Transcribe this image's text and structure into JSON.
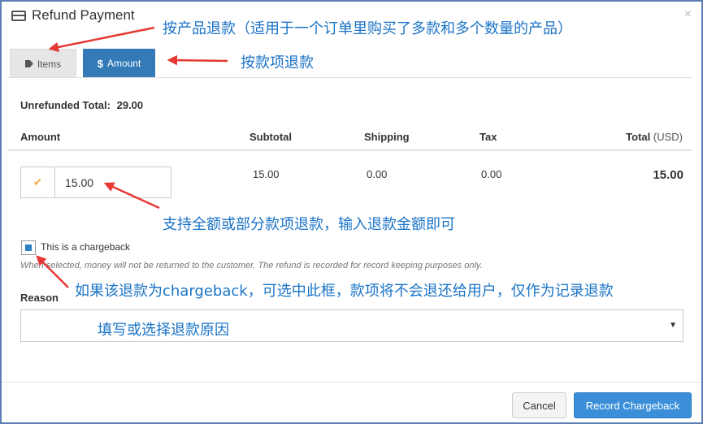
{
  "modal": {
    "title": "Refund Payment",
    "close": "×"
  },
  "tabs": [
    {
      "label": "Items",
      "icon": "tag-icon",
      "active": false
    },
    {
      "label": "Amount",
      "icon": "dollar-icon",
      "prefix": "$",
      "active": true
    }
  ],
  "summary": {
    "unrefunded_label": "Unrefunded Total:",
    "unrefunded_value": "29.00"
  },
  "table": {
    "headers": {
      "amount": "Amount",
      "subtotal": "Subtotal",
      "shipping": "Shipping",
      "tax": "Tax",
      "total": "Total",
      "currency": "(USD)"
    },
    "row": {
      "amount_value": "15.00",
      "subtotal": "15.00",
      "shipping": "0.00",
      "tax": "0.00",
      "total": "15.00"
    }
  },
  "chargeback": {
    "label": "This is a chargeback",
    "checked": true,
    "help": "When selected, money will not be returned to the customer. The refund is recorded for record keeping purposes only."
  },
  "reason": {
    "label": "Reason",
    "value": ""
  },
  "buttons": {
    "cancel": "Cancel",
    "submit": "Record Chargeback"
  },
  "annotations": {
    "by_product": "按产品退款（适用于一个订单里购买了多款和多个数量的产品）",
    "by_amount": "按款项退款",
    "full_partial": "支持全额或部分款项退款，输入退款金额即可",
    "chargeback_note": "如果该退款为chargeback，可选中此框，款项将不会退还给用户，仅作为记录退款",
    "reason_hint": "填写或选择退款原因"
  },
  "colors": {
    "accent": "#337ab7",
    "annotation": "#1a73c7",
    "arrow": "#e53935",
    "check": "#f0ad4e"
  }
}
